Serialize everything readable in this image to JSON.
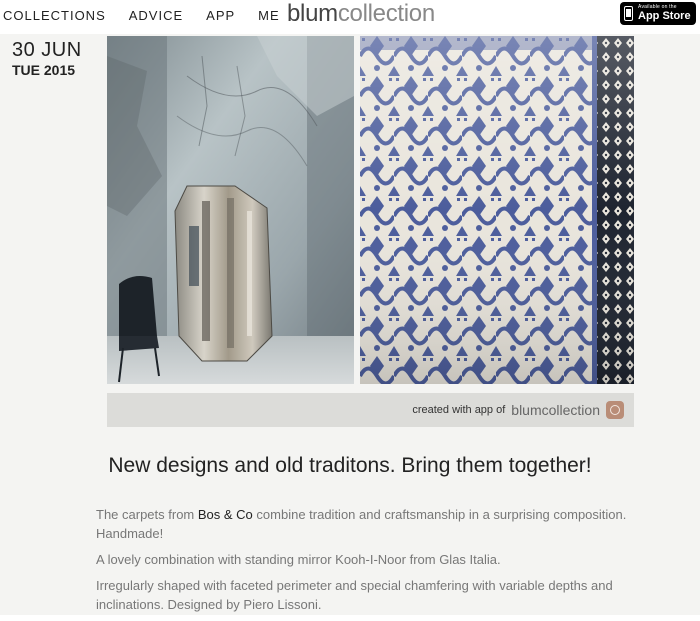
{
  "nav": {
    "items": [
      {
        "label": "COLLECTIONS"
      },
      {
        "label": "ADVICE"
      },
      {
        "label": "APP"
      },
      {
        "label": "ME"
      }
    ]
  },
  "logo": {
    "part1": "blum",
    "part2": "collection"
  },
  "appstore": {
    "small": "Available on the",
    "big": "App Store"
  },
  "date": {
    "day_month": "30 JUN",
    "weekday_year": "TUE 2015"
  },
  "credit": {
    "label": "created with app of",
    "brand": "blumcollection"
  },
  "headline": "New designs and old traditons. Bring them together!",
  "paragraphs": {
    "p1_before": "The carpets from ",
    "p1_link": "Bos & Co",
    "p1_after": " combine tradition and craftsmanship in a surprising composition. Handmade!",
    "p2": "A lovely combination with standing mirror Kooh-I-Noor from Glas Italia.",
    "p3": "Irregularly shaped with faceted perimeter and special chamfering with variable depths and inclinations. Designed by Piero Lissoni."
  },
  "colors": {
    "carpet_blue": "#4e5f9e",
    "carpet_cream": "#e8e4dc",
    "wall_gray": "#9aa5ab",
    "badge": "#b98d77"
  }
}
